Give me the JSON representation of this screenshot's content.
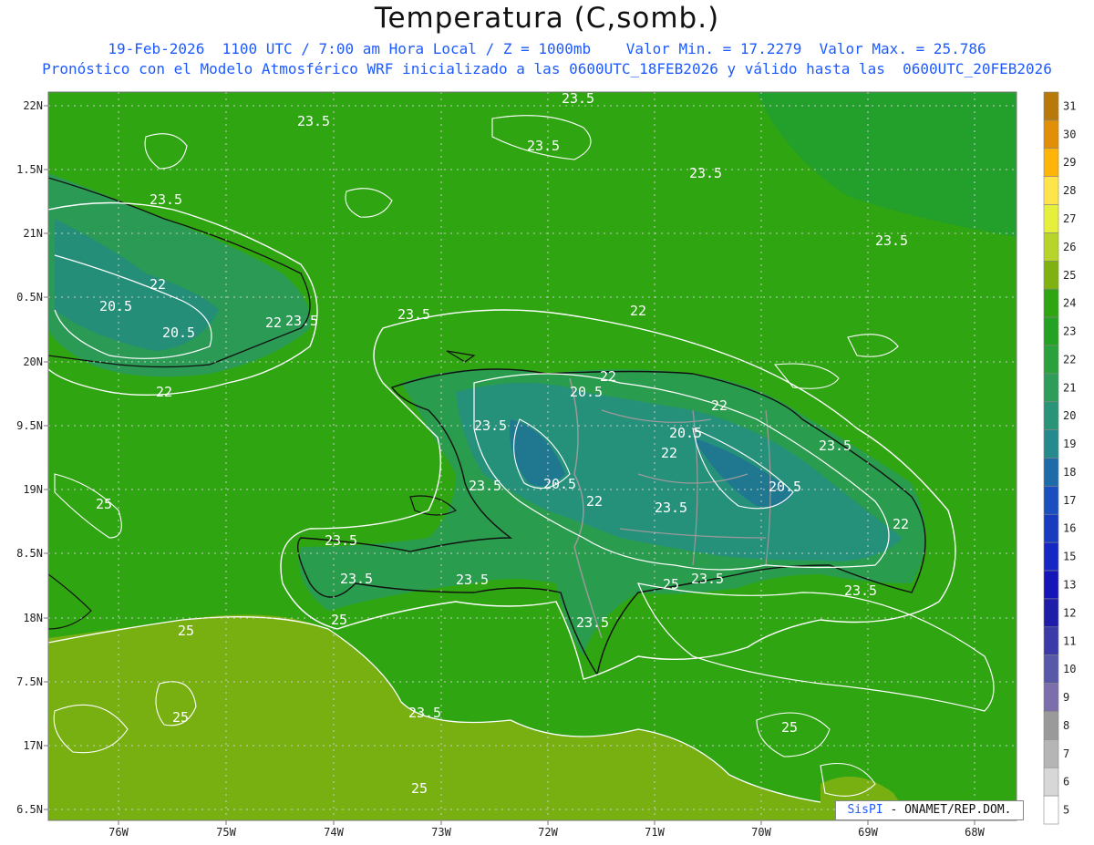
{
  "header": {
    "title": "Temperatura (C,somb.)",
    "line1": "19-Feb-2026  1100 UTC / 7:00 am Hora Local / Z = 1000mb    Valor Min. = 17.2279  Valor Max. = 25.786",
    "line2": "Pronóstico con el Modelo Atmosférico WRF inicializado a las 0600UTC_18FEB2026 y válido hasta las  0600UTC_20FEB2026"
  },
  "axes": {
    "lon_labels": [
      "76W",
      "75W",
      "74W",
      "73W",
      "72W",
      "71W",
      "70W",
      "69W",
      "68W"
    ],
    "lat_labels": [
      "22N",
      "1.5N",
      "21N",
      "0.5N",
      "20N",
      "9.5N",
      "19N",
      "8.5N",
      "18N",
      "7.5N",
      "17N",
      "6.5N"
    ]
  },
  "colorbar": {
    "labels": [
      "31",
      "30",
      "29",
      "28",
      "27",
      "26",
      "25",
      "24",
      "23",
      "22",
      "21",
      "20",
      "19",
      "18",
      "17",
      "16",
      "15",
      "13",
      "12",
      "11",
      "10",
      "9",
      "8",
      "7",
      "6",
      "5"
    ],
    "colors": [
      "#b8790a",
      "#e08f06",
      "#ffb40a",
      "#ffe44c",
      "#e6f03c",
      "#b6d42a",
      "#7fb210",
      "#2fa512",
      "#23a321",
      "#2aa13c",
      "#2f9d5a",
      "#2a9478",
      "#248a8c",
      "#1d6ba8",
      "#1a4fc0",
      "#173cbf",
      "#1628c4",
      "#1515b8",
      "#1d1daa",
      "#3a3aa8",
      "#5858a8",
      "#7b6eaa",
      "#9a9a9a",
      "#b5b5b5",
      "#d7d7d7",
      "#ffffff"
    ]
  },
  "contour_labels": [
    "23.5",
    "23.5",
    "23.5",
    "23.5",
    "23.5",
    "23.5",
    "22",
    "20.5",
    "20.5",
    "22",
    "23.5",
    "22",
    "23.5",
    "22",
    "20.5",
    "22",
    "20.5",
    "22",
    "23.5",
    "20.5",
    "23.5",
    "20.5",
    "22",
    "22",
    "23.5",
    "23.5",
    "23.5",
    "23.5",
    "23.5",
    "23.5",
    "22",
    "23.5",
    "25",
    "23.5",
    "25",
    "25",
    "25",
    "25",
    "23.5",
    "25",
    "25"
  ],
  "credit": {
    "brand": "SisPI",
    "text": " - ONAMET/REP.DOM."
  }
}
